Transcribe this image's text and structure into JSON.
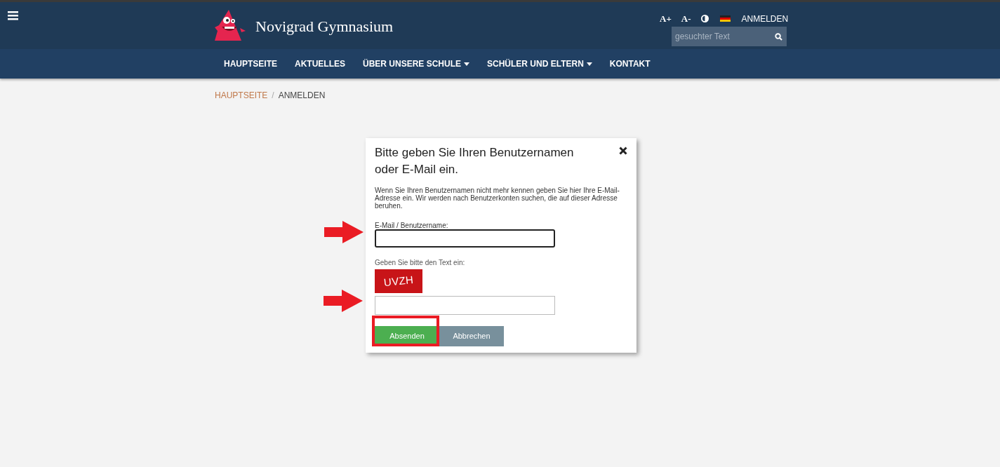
{
  "header": {
    "site_title": "Novigrad Gymnasium",
    "tools": [
      "A+",
      "A-"
    ],
    "login": "ANMELDEN",
    "search": {
      "placeholder": "gesuchter Text"
    }
  },
  "nav": [
    {
      "label": "HAUPTSEITE",
      "dropdown": false
    },
    {
      "label": "AKTUELLES",
      "dropdown": false
    },
    {
      "label": "ÜBER UNSERE SCHULE",
      "dropdown": true
    },
    {
      "label": "SCHÜLER UND ELTERN",
      "dropdown": true
    },
    {
      "label": "KONTAKT",
      "dropdown": false
    }
  ],
  "breadcrumb": {
    "items": [
      "HAUPTSEITE",
      "ANMELDEN"
    ],
    "separator": "/"
  },
  "dialog": {
    "title": "Bitte geben Sie Ihren Benutzernamen oder E-Mail ein.",
    "description": "Wenn Sie Ihren Benutzernamen nicht mehr kennen geben Sie hier Ihre E-Mail-Adresse ein. Wir werden nach Benutzerkonten suchen, die auf dieser Adresse beruhen.",
    "email_label": "E-Mail / Benutzername:",
    "captcha_label": "Geben Sie bitte den Text ein:",
    "captcha_text": "UVZH",
    "buttons": [
      {
        "label": "Absenden",
        "kind": "primary",
        "highlighted": true
      },
      {
        "label": "Abbrechen",
        "kind": "secondary",
        "highlighted": false
      }
    ]
  }
}
